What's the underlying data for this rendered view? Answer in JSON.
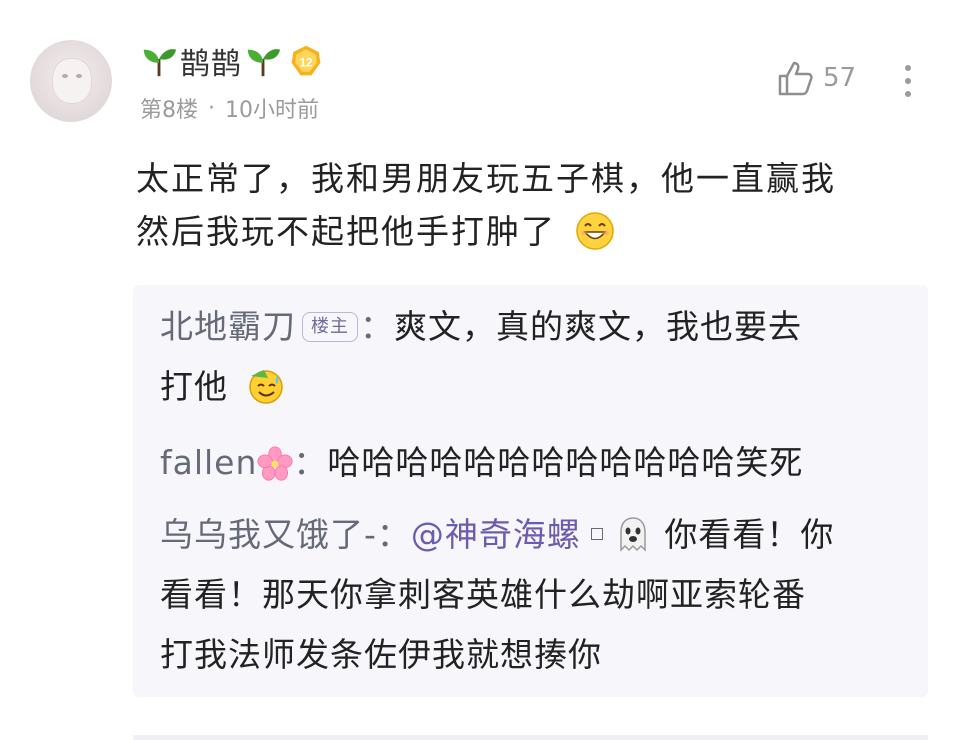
{
  "post": {
    "username": "鹊鹊",
    "level": "12",
    "floor": "第8楼",
    "separator": "·",
    "time": "10小时前",
    "likes": "57",
    "content_line1": "太正常了，我和男朋友玩五子棋，他一直赢我",
    "content_line2": "然后我玩不起把他手打肿了",
    "icons": [
      "avatar",
      "sprout-icon",
      "level-badge-icon",
      "thumbs-up-icon",
      "more-icon",
      "grin-emoji-icon"
    ]
  },
  "replies": [
    {
      "name": "北地霸刀",
      "badge": "楼主",
      "colon": "：",
      "text_line1": "爽文，真的爽文，我也要去",
      "text_line2": "打他",
      "emoji": "sweat-smile-emoji-icon"
    },
    {
      "name": "fallen",
      "colon": "：",
      "text": "哈哈哈哈哈哈哈哈哈哈哈哈笑死",
      "emoji": "cherry-blossom-icon"
    },
    {
      "name": "乌乌我又饿了-",
      "colon": "：",
      "mention": "@神奇海螺",
      "text_part1": " 你看看！你",
      "text_line2": "看看！那天你拿刺客英雄什么劫啊亚索轮番",
      "text_line3": "打我法师发条佐伊我就想揍你",
      "emoji": "ghost-icon"
    }
  ],
  "colors": {
    "name_gray": "#666a78",
    "mention_purple": "#6b5cb0",
    "meta_gray": "#9b9b9b",
    "reply_background": "#f7f7fb"
  }
}
